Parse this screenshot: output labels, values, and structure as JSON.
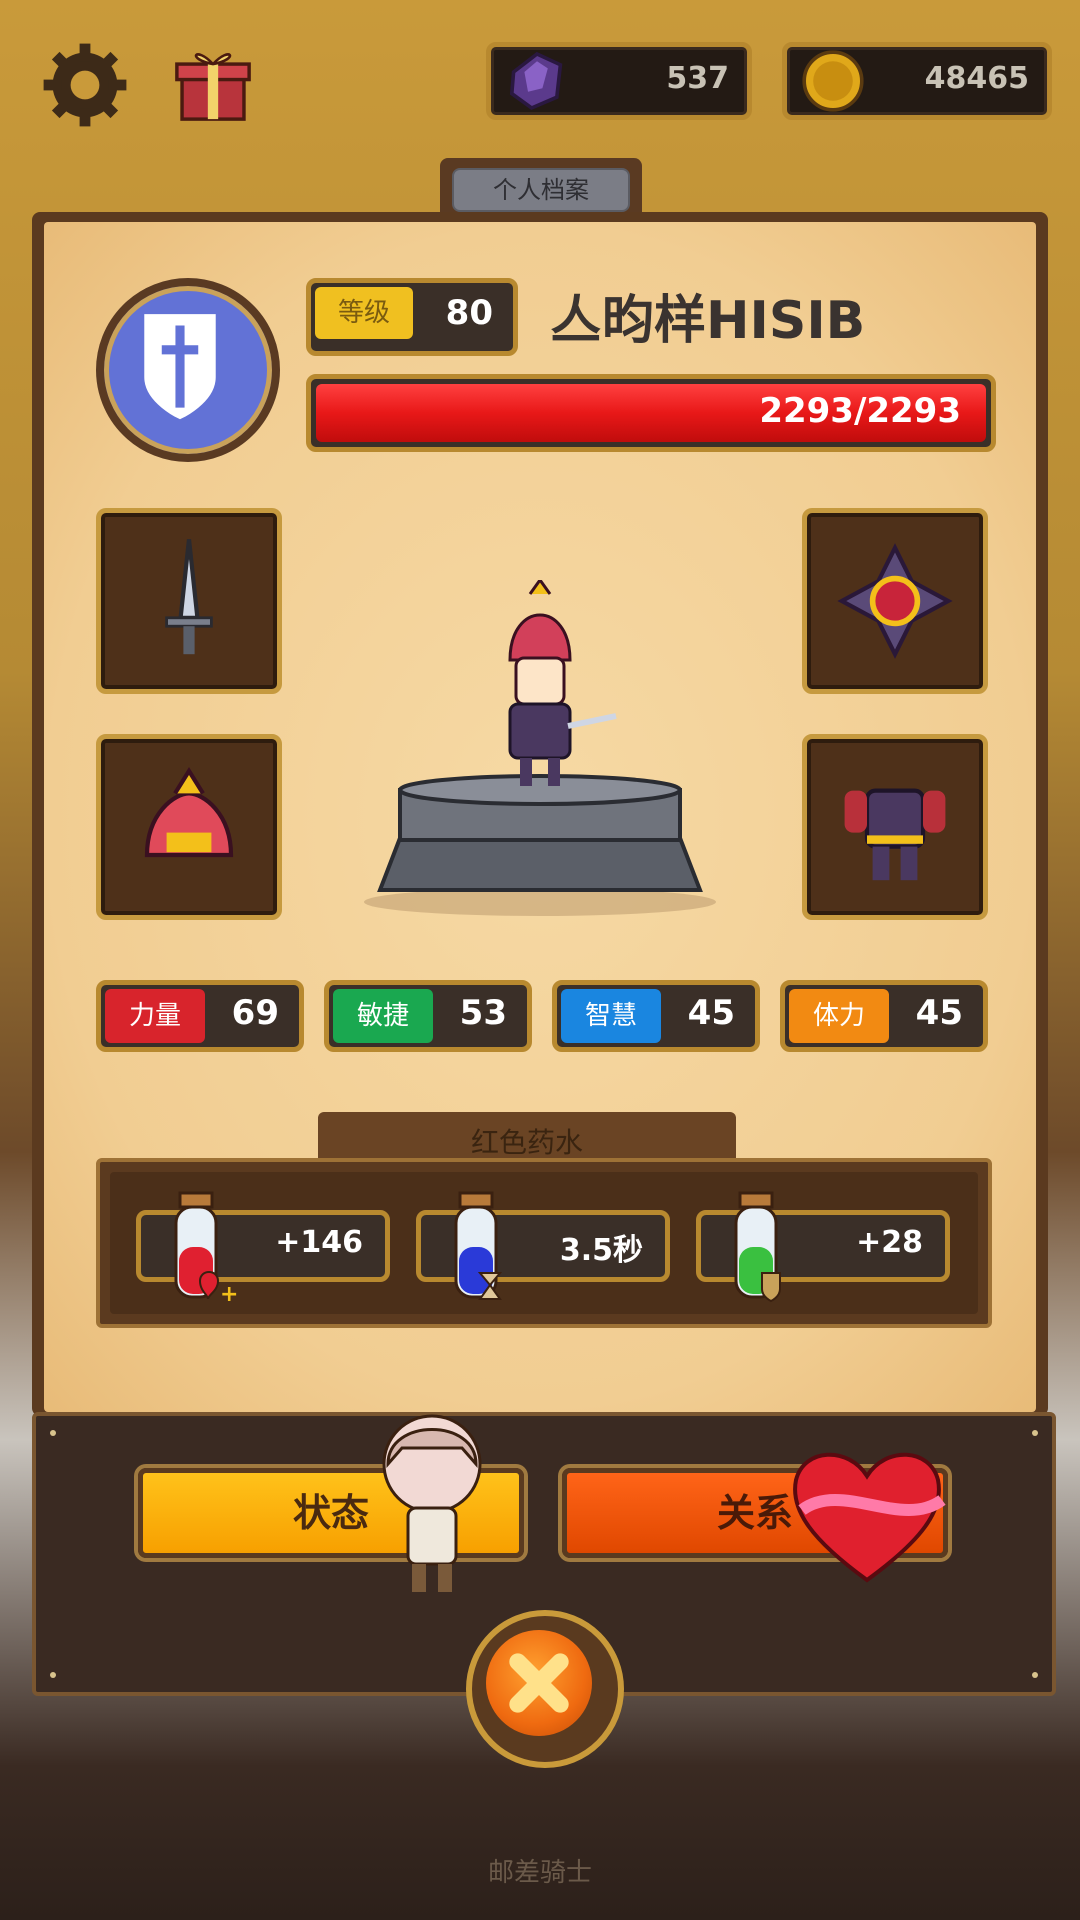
{
  "currency": {
    "gems": "537",
    "gold": "48465"
  },
  "profile_tab": "个人档案",
  "player": {
    "level_label": "等级",
    "level": "80",
    "name": "亼昀样HISIB",
    "hp_text": "2293/2293",
    "hp_fraction": 1.0
  },
  "equipment": [
    "dagger-icon",
    "amulet-icon",
    "helmet-icon",
    "armor-icon"
  ],
  "stats": [
    {
      "label": "力量",
      "value": "69",
      "color": "#d8242c"
    },
    {
      "label": "敏捷",
      "value": "53",
      "color": "#1aa850"
    },
    {
      "label": "智慧",
      "value": "45",
      "color": "#1a86e0"
    },
    {
      "label": "体力",
      "value": "45",
      "color": "#f28a12"
    }
  ],
  "potion": {
    "title": "红色药水",
    "items": [
      {
        "icon": "health-potion-icon",
        "value": "+146"
      },
      {
        "icon": "duration-potion-icon",
        "value": "3.5秒"
      },
      {
        "icon": "armor-potion-icon",
        "value": "+28"
      }
    ]
  },
  "buttons": {
    "status": "状态",
    "relation": "关系"
  },
  "footer": "邮差骑士"
}
